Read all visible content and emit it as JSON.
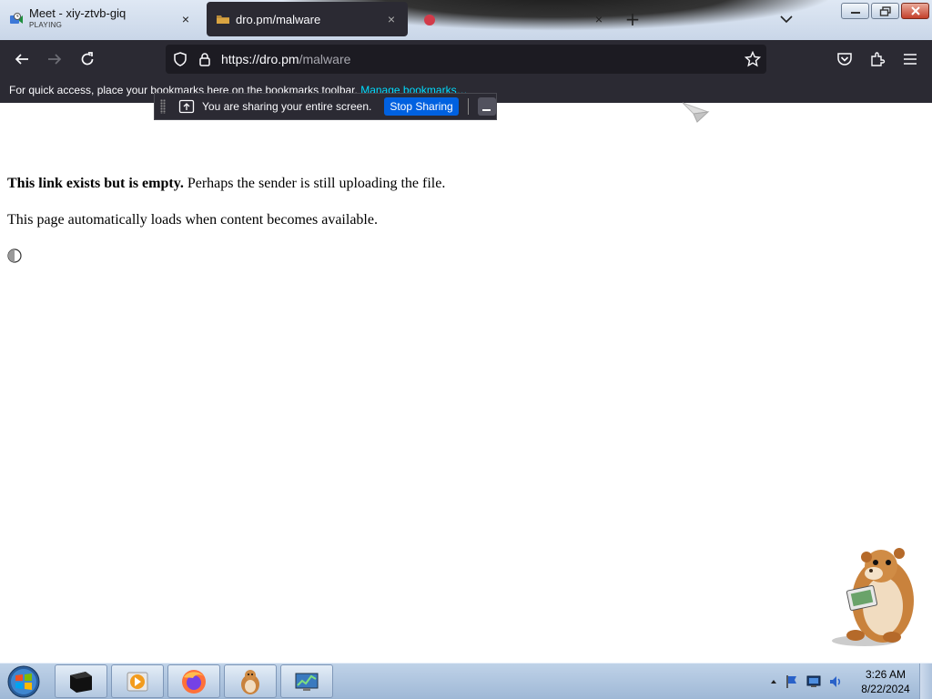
{
  "tabs": [
    {
      "title": "Meet - xiy-ztvb-giq",
      "subtitle": "PLAYING",
      "close": "×"
    },
    {
      "title": "dro.pm/malware",
      "close": "×"
    },
    {
      "close": "×"
    }
  ],
  "new_tab_symbol": "+",
  "url": {
    "scheme_host": "https://dro.pm",
    "path": "/malware"
  },
  "bookmarks_bar": {
    "text": "For quick access, place your bookmarks here on the bookmarks toolbar.",
    "link": "Manage bookmarks…"
  },
  "sharing_indicator": {
    "text": "You are sharing your entire screen.",
    "stop_label": "Stop Sharing"
  },
  "page": {
    "bold": "This link exists but is empty.",
    "rest": " Perhaps the sender is still uploading the file.",
    "line2": "This page automatically loads when content becomes available."
  },
  "clock": {
    "time": "3:26 AM",
    "date": "8/22/2024"
  },
  "icons": [
    "back-icon",
    "forward-icon",
    "reload-icon",
    "tracking-protection-icon",
    "lock-icon",
    "bookmark-star-icon",
    "pocket-icon",
    "extensions-icon",
    "menu-icon",
    "share-screen-icon",
    "loading-spinner-icon"
  ],
  "colors": {
    "toolbar": "#2b2a33",
    "urlbar": "#1c1b22",
    "link": "#00ddff",
    "stop_button": "#0061e0"
  }
}
